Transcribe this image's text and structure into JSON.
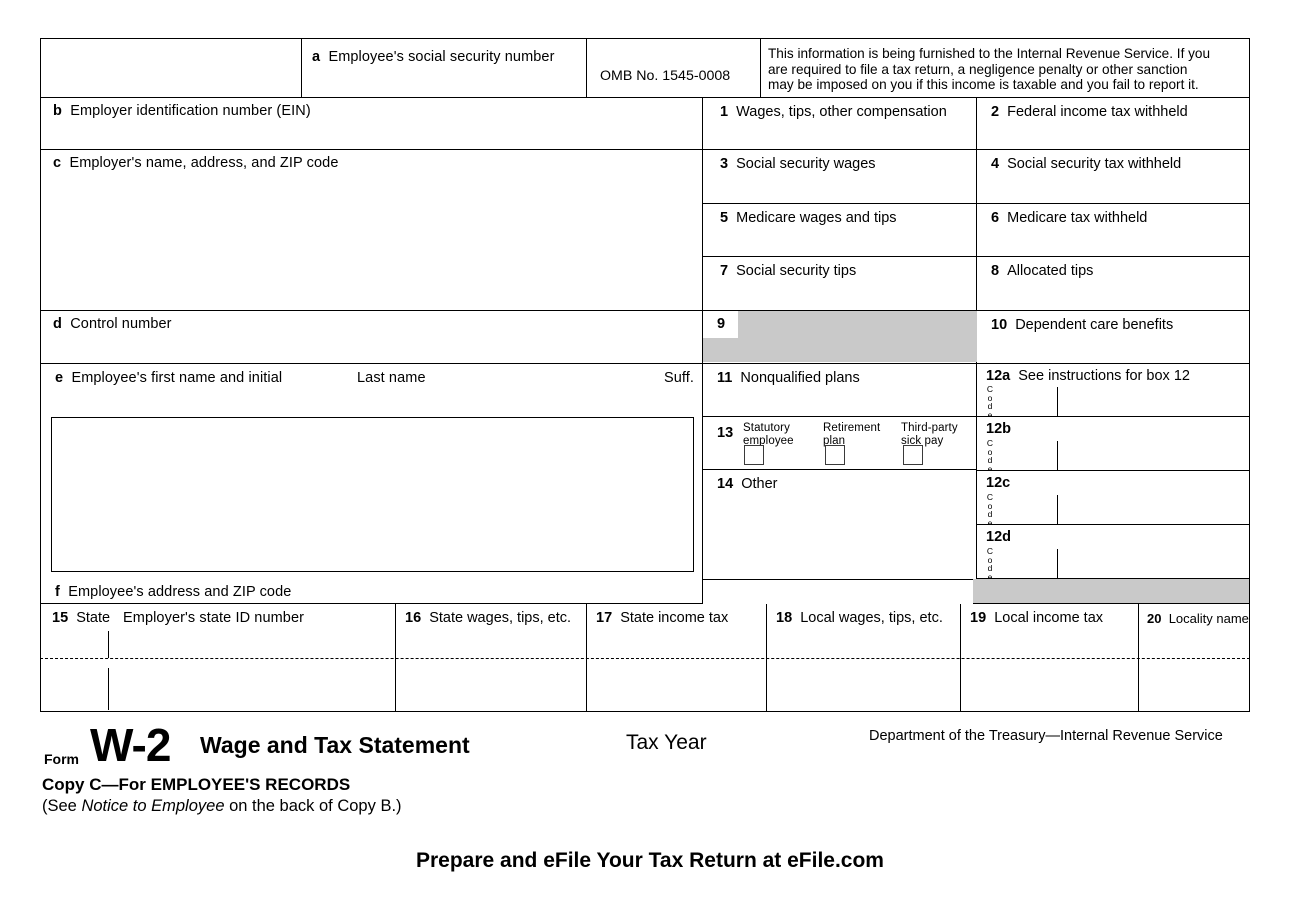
{
  "form": {
    "omb_number": "OMB No. 1545-0008",
    "irs_notice_line1": "This information is being furnished to the Internal Revenue Service. If you",
    "irs_notice_line2": "are required to file a tax return, a negligence penalty or other sanction",
    "irs_notice_line3": "may be imposed on you if this income is taxable and you fail to report it."
  },
  "lettered_boxes": {
    "a_letter": "a",
    "a_label": "Employee's social security number",
    "b_letter": "b",
    "b_label": "Employer identification number (EIN)",
    "c_letter": "c",
    "c_label": "Employer's name, address, and ZIP code",
    "d_letter": "d",
    "d_label": "Control number",
    "e_letter": "e",
    "e_label": "Employee's first name and initial",
    "e_last_name": "Last name",
    "e_suffix": "Suff.",
    "f_letter": "f",
    "f_label": "Employee's address and ZIP code"
  },
  "numbered_boxes": {
    "b1_num": "1",
    "b1_label": "Wages, tips, other compensation",
    "b2_num": "2",
    "b2_label": "Federal income tax withheld",
    "b3_num": "3",
    "b3_label": "Social security wages",
    "b4_num": "4",
    "b4_label": "Social security tax withheld",
    "b5_num": "5",
    "b5_label": "Medicare wages and tips",
    "b6_num": "6",
    "b6_label": "Medicare tax withheld",
    "b7_num": "7",
    "b7_label": "Social security tips",
    "b8_num": "8",
    "b8_label": "Allocated tips",
    "b9_num": "9",
    "b9_label": "",
    "b10_num": "10",
    "b10_label": "Dependent care benefits",
    "b11_num": "11",
    "b11_label": "Nonqualified plans",
    "b12a_num": "12a",
    "b12a_label": "See instructions for box 12",
    "b12b_num": "12b",
    "b12b_label": "",
    "b12c_num": "12c",
    "b12c_label": "",
    "b12d_num": "12d",
    "b12d_label": "",
    "b13_num": "13",
    "b13_check1_line1": "Statutory",
    "b13_check1_line2": "employee",
    "b13_check2_line1": "Retirement",
    "b13_check2_line2": "plan",
    "b13_check3_line1": "Third-party",
    "b13_check3_line2": "sick pay",
    "b14_num": "14",
    "b14_label": "Other",
    "b15_num": "15",
    "b15_state": "State",
    "b15_label": "Employer's state ID number",
    "b16_num": "16",
    "b16_label": "State wages, tips, etc.",
    "b17_num": "17",
    "b17_label": "State income tax",
    "b18_num": "18",
    "b18_label": "Local wages, tips, etc.",
    "b19_num": "19",
    "b19_label": "Local income tax",
    "b20_num": "20",
    "b20_label": "Locality name",
    "code_letters": [
      "C",
      "o",
      "d",
      "e"
    ]
  },
  "footer": {
    "form_word": "Form",
    "form_number": "W-2",
    "form_title": "Wage and Tax Statement",
    "tax_year": "Tax Year",
    "department": "Department of the Treasury—Internal Revenue Service",
    "copy_line": "Copy C—For EMPLOYEE'S RECORDS",
    "notice_prefix": "(See ",
    "notice_italic": "Notice to Employee",
    "notice_suffix": " on the back of Copy B.)",
    "promo": "Prepare and eFile Your Tax Return at eFile.com"
  }
}
